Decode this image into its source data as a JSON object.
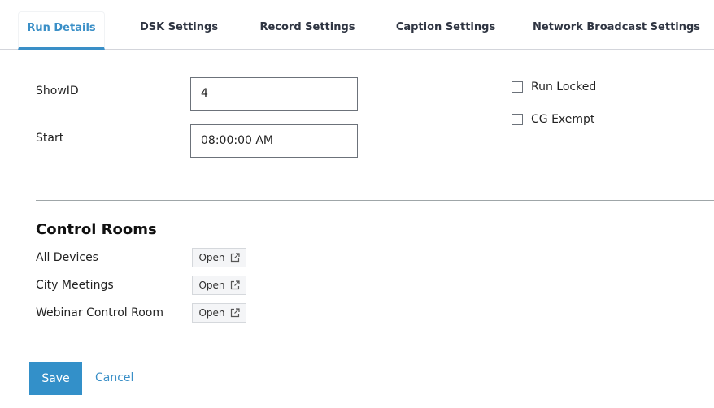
{
  "tabs": [
    {
      "label": "Run Details",
      "active": true
    },
    {
      "label": "DSK Settings",
      "active": false
    },
    {
      "label": "Record Settings",
      "active": false
    },
    {
      "label": "Caption Settings",
      "active": false
    },
    {
      "label": "Network Broadcast Settings",
      "active": false
    }
  ],
  "form": {
    "showid": {
      "label": "ShowID",
      "value": "4"
    },
    "start": {
      "label": "Start",
      "value": "08:00:00 AM"
    },
    "run_locked": {
      "label": "Run Locked",
      "checked": false
    },
    "cg_exempt": {
      "label": "CG Exempt",
      "checked": false
    }
  },
  "control_rooms": {
    "title": "Control Rooms",
    "open_label": "Open",
    "open_icon": "external-link-icon",
    "items": [
      {
        "name": "All Devices"
      },
      {
        "name": "City Meetings"
      },
      {
        "name": "Webinar Control Room"
      }
    ]
  },
  "actions": {
    "save_label": "Save",
    "cancel_label": "Cancel"
  },
  "colors": {
    "accent": "#3390c9"
  }
}
